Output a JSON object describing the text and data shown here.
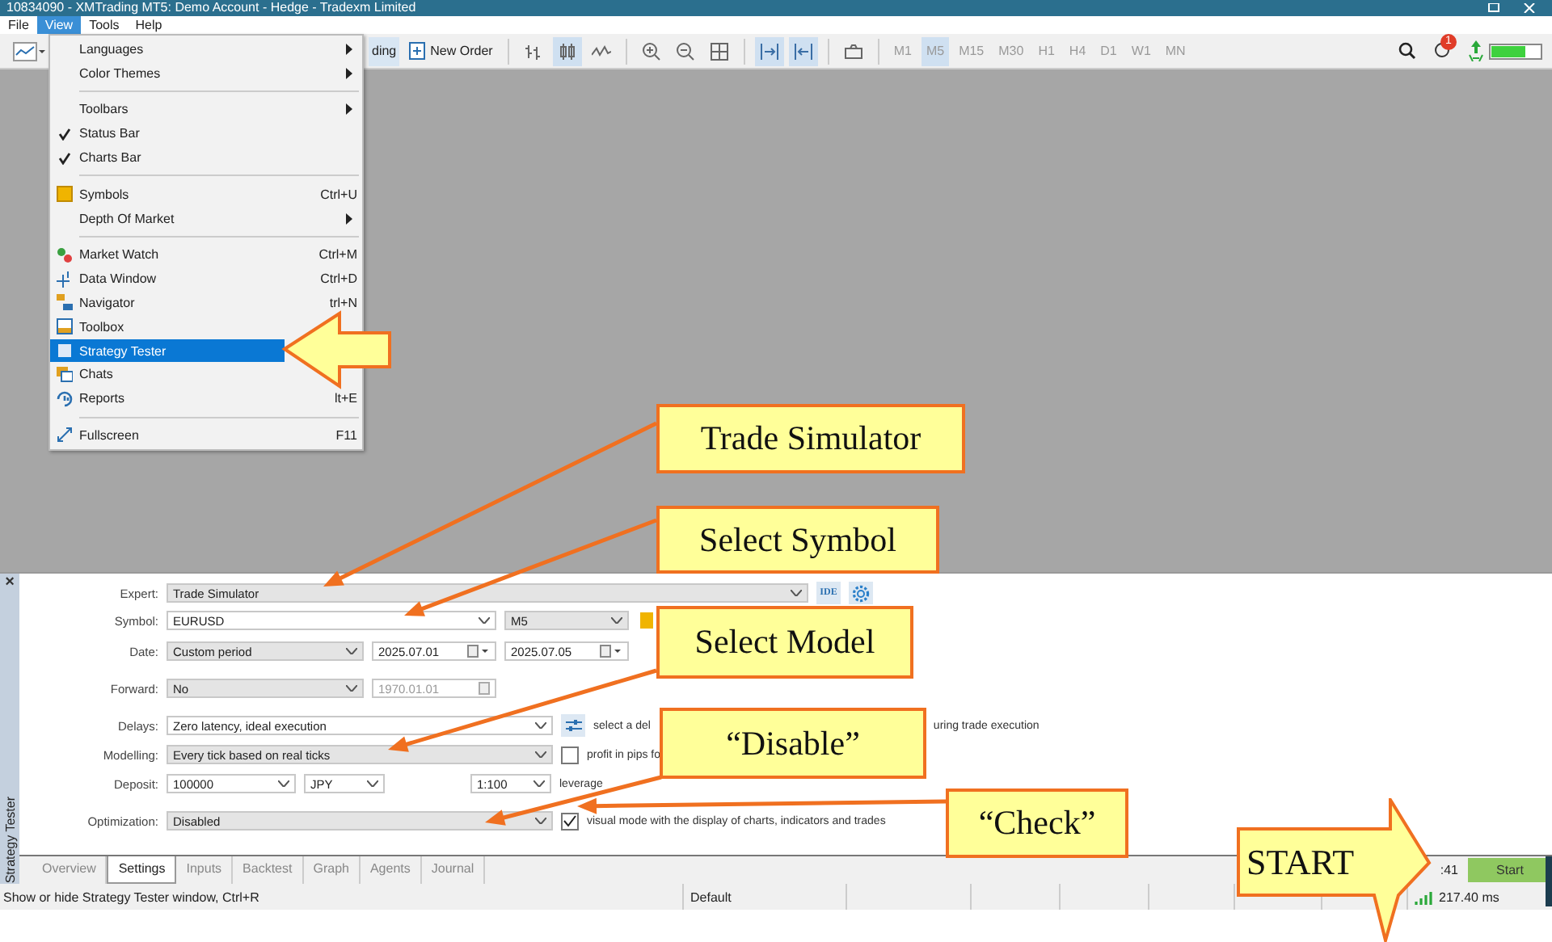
{
  "window": {
    "title": "10834090 - XMTrading MT5: Demo Account - Hedge - Tradexm Limited"
  },
  "menubar": [
    {
      "label": "File",
      "selected": false
    },
    {
      "label": "View",
      "selected": true
    },
    {
      "label": "Tools",
      "selected": false
    },
    {
      "label": "Help",
      "selected": false
    }
  ],
  "view_menu": [
    {
      "kind": "submenu",
      "label": "Languages",
      "checked": false,
      "selected": false
    },
    {
      "kind": "submenu",
      "label": "Color Themes",
      "checked": false,
      "selected": false
    },
    {
      "kind": "separator"
    },
    {
      "kind": "submenu",
      "label": "Toolbars",
      "checked": false,
      "selected": false
    },
    {
      "kind": "item",
      "label": "Status Bar",
      "checked": true,
      "selected": false
    },
    {
      "kind": "item",
      "label": "Charts Bar",
      "checked": true,
      "selected": false
    },
    {
      "kind": "separator"
    },
    {
      "kind": "item",
      "label": "Symbols",
      "shortcut": "Ctrl+U",
      "checked": false,
      "selected": false
    },
    {
      "kind": "submenu",
      "label": "Depth Of Market",
      "checked": false,
      "selected": false
    },
    {
      "kind": "separator"
    },
    {
      "kind": "item",
      "label": "Market Watch",
      "shortcut": "Ctrl+M",
      "checked": false,
      "selected": false
    },
    {
      "kind": "item",
      "label": "Data Window",
      "shortcut": "Ctrl+D",
      "checked": false,
      "selected": false
    },
    {
      "kind": "item",
      "label": "Navigator",
      "shortcut": "trl+N",
      "checked": false,
      "selected": false
    },
    {
      "kind": "item",
      "label": "Toolbox",
      "checked": false,
      "selected": false
    },
    {
      "kind": "item",
      "label": "Strategy Tester",
      "checked": false,
      "selected": true
    },
    {
      "kind": "item",
      "label": "Chats",
      "checked": false,
      "selected": false
    },
    {
      "kind": "item",
      "label": "Reports",
      "shortcut": "lt+E",
      "checked": false,
      "selected": false
    },
    {
      "kind": "separator"
    },
    {
      "kind": "item",
      "label": "Fullscreen",
      "shortcut": "F11",
      "checked": false,
      "selected": false
    }
  ],
  "toolbar": {
    "algo_trading": "ding",
    "new_order": "New Order",
    "tools": [
      {
        "selected": false
      },
      {
        "selected": true
      },
      {
        "selected": false
      },
      {
        "selected": false
      },
      {
        "selected": false
      },
      {
        "selected": false
      },
      {
        "selected": true
      },
      {
        "selected": true
      },
      {
        "selected": false
      }
    ],
    "timeframes": [
      {
        "label": "M1",
        "selected": false
      },
      {
        "label": "M5",
        "selected": true
      },
      {
        "label": "M15",
        "selected": false
      },
      {
        "label": "M30",
        "selected": false
      },
      {
        "label": "H1",
        "selected": false
      },
      {
        "label": "H4",
        "selected": false
      },
      {
        "label": "D1",
        "selected": false
      },
      {
        "label": "W1",
        "selected": false
      },
      {
        "label": "MN",
        "selected": false
      }
    ],
    "notification_count": "1"
  },
  "tester": {
    "close": "×",
    "side_label": "Strategy Tester",
    "expert": {
      "label": "Expert:",
      "value": "Trade Simulator"
    },
    "ide_button": "IDE",
    "symbol": {
      "label": "Symbol:",
      "value": "EURUSD",
      "period": "M5"
    },
    "date": {
      "label": "Date:",
      "value": "Custom period",
      "from": "2025.07.01",
      "to": "2025.07.05"
    },
    "forward": {
      "label": "Forward:",
      "value": "No",
      "date": "1970.01.01",
      "disabled": true
    },
    "delays": {
      "label": "Delays:",
      "value": "Zero latency, ideal execution",
      "note_start": "select a del",
      "note_end": "uring trade execution"
    },
    "modelling": {
      "label": "Modelling:",
      "value": "Every tick based on real ticks",
      "option": "profit in pips fo",
      "checked": false
    },
    "deposit": {
      "label": "Deposit:",
      "value": "100000",
      "currency": "JPY",
      "leverage": "1:100",
      "leverage_label": "leverage"
    },
    "optimization": {
      "label": "Optimization:",
      "value": "Disabled",
      "option": "visual mode with the display of charts, indicators and trades",
      "checked": true
    },
    "tabs": [
      {
        "label": "Overview",
        "selected": false
      },
      {
        "label": "Settings",
        "selected": true
      },
      {
        "label": "Inputs",
        "selected": false
      },
      {
        "label": "Backtest",
        "selected": false
      },
      {
        "label": "Graph",
        "selected": false
      },
      {
        "label": "Agents",
        "selected": false
      },
      {
        "label": "Journal",
        "selected": false
      }
    ],
    "time": ":41",
    "start_button": "Start"
  },
  "status_bar": {
    "message": "Show or hide Strategy Tester window, Ctrl+R",
    "profile": "Default",
    "ping": "217.40 ms"
  },
  "callouts": [
    {
      "kind": "box",
      "text": "Trade Simulator"
    },
    {
      "kind": "box",
      "text": "Select Symbol"
    },
    {
      "kind": "box",
      "text": "Select Model"
    },
    {
      "kind": "box",
      "text": "“Disable”"
    },
    {
      "kind": "box",
      "text": "“Check”"
    },
    {
      "kind": "arrow",
      "text": "START"
    }
  ]
}
